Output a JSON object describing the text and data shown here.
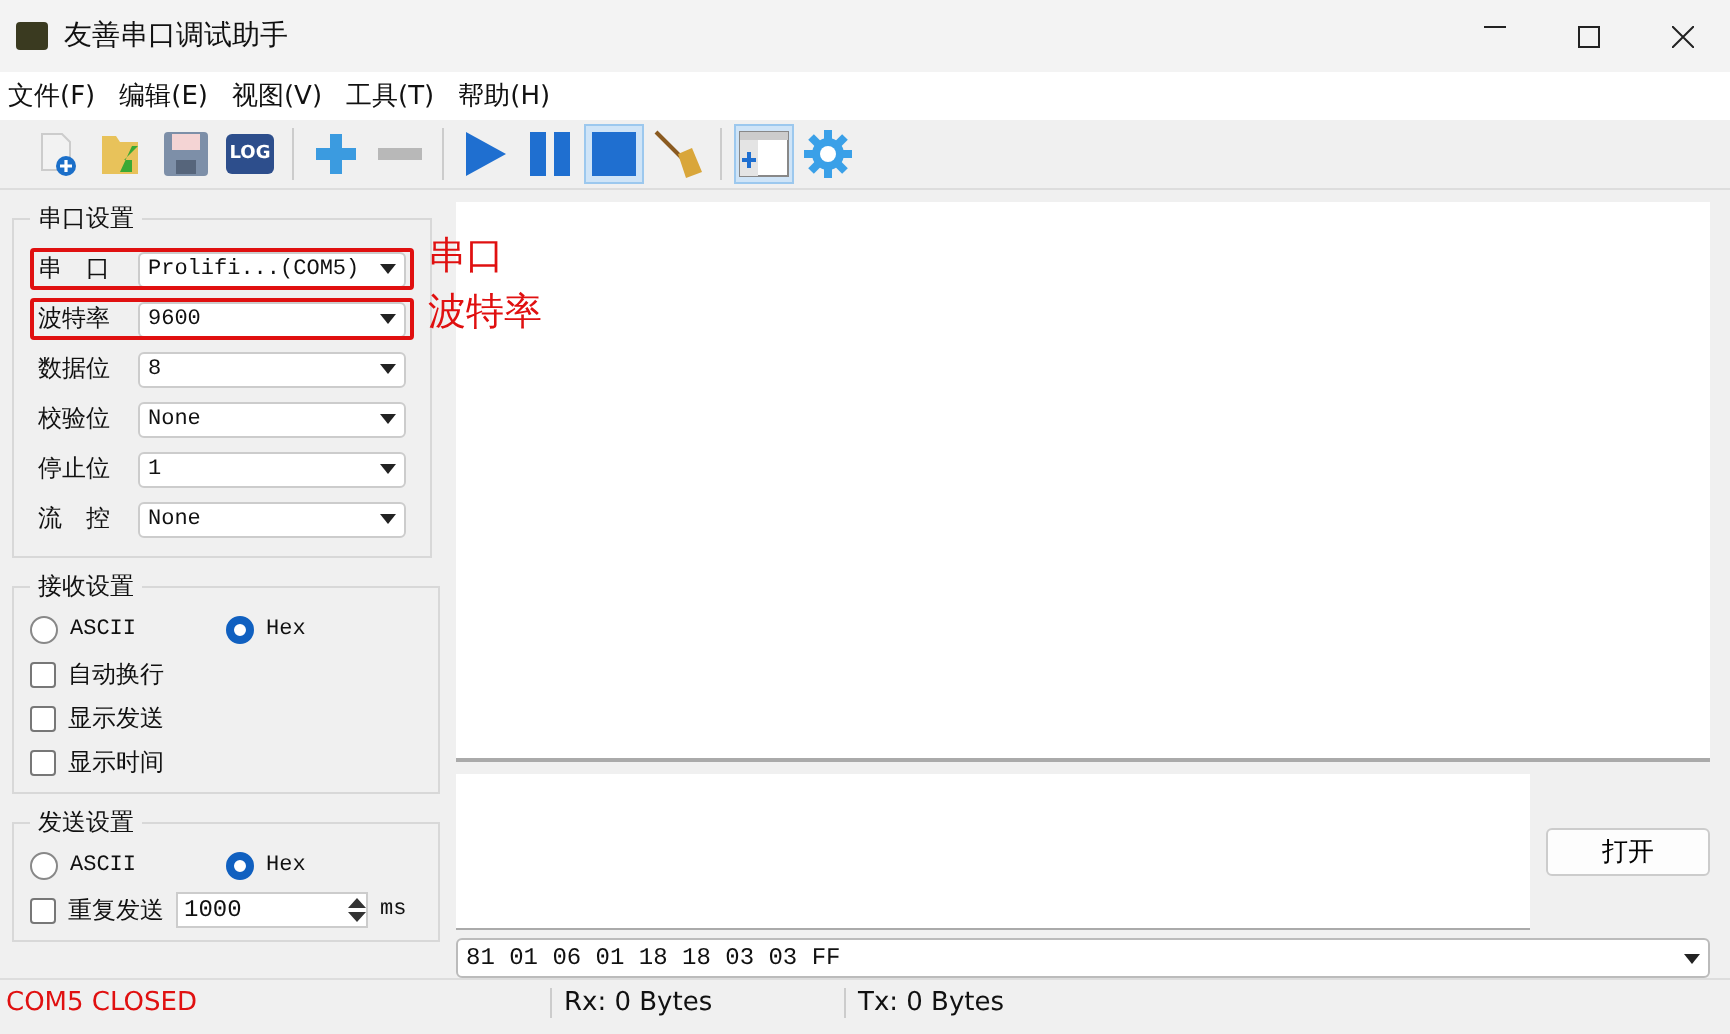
{
  "window": {
    "title": "友善串口调试助手"
  },
  "menu": [
    {
      "label": "文件(F)"
    },
    {
      "label": "编辑(E)"
    },
    {
      "label": "视图(V)"
    },
    {
      "label": "工具(T)"
    },
    {
      "label": "帮助(H)"
    }
  ],
  "toolbar": [
    {
      "kind": "new",
      "pressed": false
    },
    {
      "kind": "open",
      "pressed": false
    },
    {
      "kind": "save",
      "pressed": false
    },
    {
      "kind": "log",
      "label": "LOG",
      "pressed": false
    },
    {
      "kind": "sep"
    },
    {
      "kind": "add",
      "pressed": false
    },
    {
      "kind": "remove",
      "pressed": false
    },
    {
      "kind": "sep"
    },
    {
      "kind": "start",
      "pressed": false
    },
    {
      "kind": "pause",
      "pressed": false
    },
    {
      "kind": "stop",
      "pressed": true
    },
    {
      "kind": "clear",
      "pressed": false
    },
    {
      "kind": "sep"
    },
    {
      "kind": "window",
      "pressed": true
    },
    {
      "kind": "settings",
      "pressed": false
    }
  ],
  "serial_settings": {
    "title": "串口设置",
    "fields": [
      {
        "label": "串　口",
        "value": "Prolifi...(COM5)",
        "highlighted": true
      },
      {
        "label": "波特率",
        "value": "9600",
        "highlighted": true
      },
      {
        "label": "数据位",
        "value": "8",
        "highlighted": false
      },
      {
        "label": "校验位",
        "value": "None",
        "highlighted": false
      },
      {
        "label": "停止位",
        "value": "1",
        "highlighted": false
      },
      {
        "label": "流　控",
        "value": "None",
        "highlighted": false
      }
    ]
  },
  "annotations": [
    {
      "text": "串口"
    },
    {
      "text": "波特率"
    }
  ],
  "receive_settings": {
    "title": "接收设置",
    "encodings": [
      {
        "label": "ASCII",
        "selected": false
      },
      {
        "label": "Hex",
        "selected": true
      }
    ],
    "options": [
      {
        "label": "自动换行",
        "checked": false
      },
      {
        "label": "显示发送",
        "checked": false
      },
      {
        "label": "显示时间",
        "checked": false
      }
    ]
  },
  "send_settings": {
    "title": "发送设置",
    "encodings": [
      {
        "label": "ASCII",
        "selected": false
      },
      {
        "label": "Hex",
        "selected": true
      }
    ],
    "repeat": {
      "label": "重复发送",
      "checked": false,
      "value": "1000",
      "unit": "ms"
    }
  },
  "open_button": {
    "label": "打开"
  },
  "command_field": {
    "value": "81 01 06 01 18 18 03 03 FF"
  },
  "status_bar": {
    "port_status": "COM5 CLOSED",
    "rx": "Rx: 0 Bytes",
    "tx": "Tx: 0 Bytes"
  }
}
